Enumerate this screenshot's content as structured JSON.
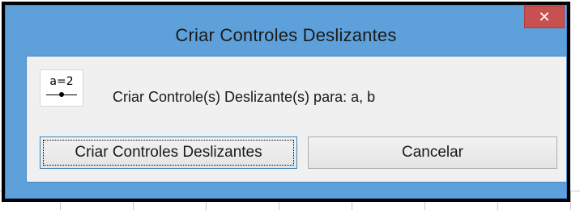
{
  "dialog": {
    "title": "Criar Controles Deslizantes",
    "close_label": "✕",
    "icon_text": "a=2",
    "message": "Criar Controle(s) Deslizante(s) para: a, b",
    "primary_button": "Criar Controles Deslizantes",
    "cancel_button": "Cancelar"
  },
  "colors": {
    "frame": "#5ea1da",
    "close": "#c75050",
    "client": "#f0f0f0"
  },
  "icons": {
    "close": "close-icon",
    "slider": "slider-icon"
  }
}
